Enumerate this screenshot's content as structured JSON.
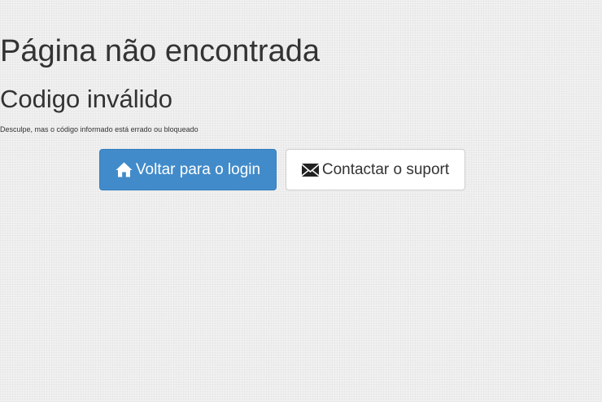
{
  "page": {
    "title": "Página não encontrada",
    "subtitle": "Codigo inválido",
    "message": "Desculpe, mas o código informado está errado ou bloqueado"
  },
  "actions": {
    "login_button": {
      "label": "Voltar para o login",
      "icon": "home-icon"
    },
    "support_button": {
      "label": "Contactar o suport",
      "icon": "envelope-icon"
    }
  },
  "colors": {
    "primary": "#428bca",
    "primary_border": "#357ebd",
    "text": "#333333",
    "background": "#f1f1f1"
  }
}
